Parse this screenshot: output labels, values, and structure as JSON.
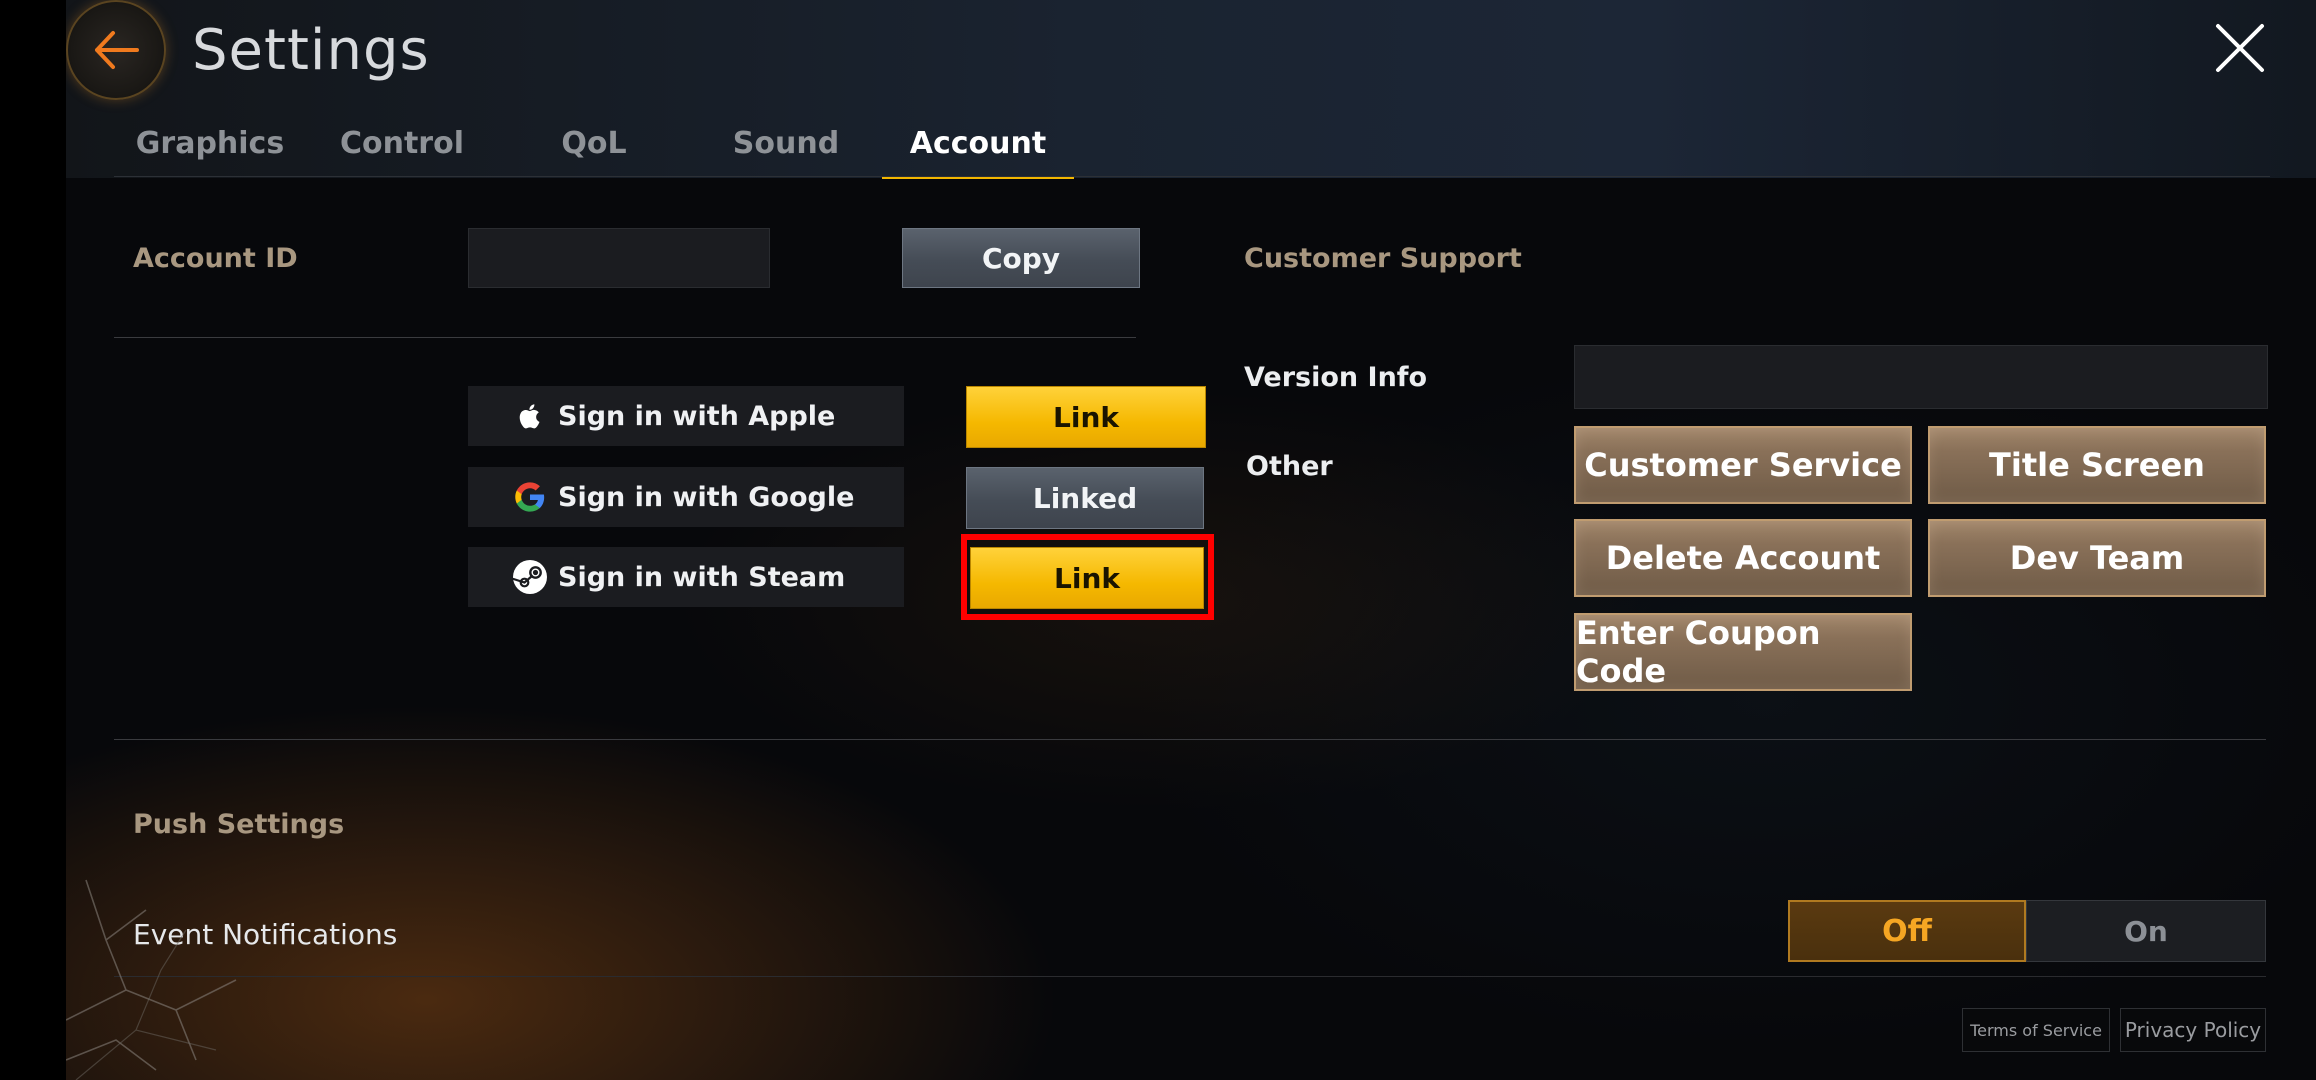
{
  "header": {
    "title": "Settings"
  },
  "tabs": [
    {
      "label": "Graphics"
    },
    {
      "label": "Control"
    },
    {
      "label": "QoL"
    },
    {
      "label": "Sound"
    },
    {
      "label": "Account",
      "active": true
    }
  ],
  "account": {
    "id_label": "Account ID",
    "id_value": "",
    "copy_label": "Copy",
    "signins": [
      {
        "label": "Sign in with Apple",
        "icon": "apple-icon",
        "action": "Link"
      },
      {
        "label": "Sign in with Google",
        "icon": "google-icon",
        "action": "Linked"
      },
      {
        "label": "Sign in with Steam",
        "icon": "steam-icon",
        "action": "Link"
      }
    ]
  },
  "support": {
    "title": "Customer Support",
    "version_label": "Version Info",
    "version_value": "",
    "other_label": "Other",
    "buttons": {
      "customer_service": "Customer Service",
      "title_screen": "Title Screen",
      "delete_account": "Delete Account",
      "dev_team": "Dev Team",
      "coupon": "Enter Coupon Code"
    }
  },
  "push": {
    "title": "Push Settings",
    "event_label": "Event Notifications",
    "off_label": "Off",
    "on_label": "On",
    "selected": "Off"
  },
  "footer": {
    "terms": "Terms of Service",
    "privacy": "Privacy Policy"
  },
  "colors": {
    "accent_gold": "#f5b800",
    "section_label": "#a89780",
    "highlight": "#ff0000",
    "toggle_active": "#f5a623"
  }
}
